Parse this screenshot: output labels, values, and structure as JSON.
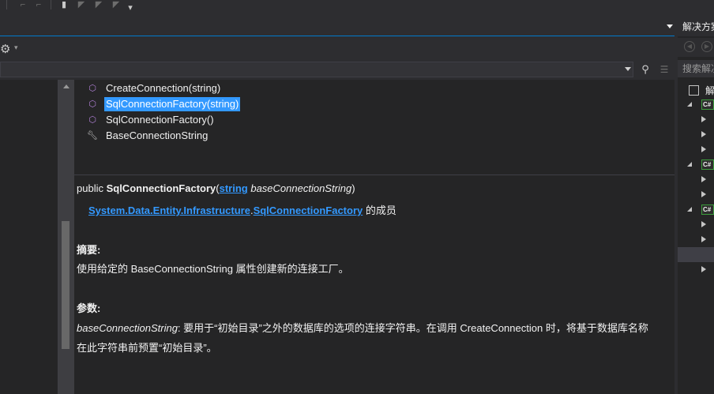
{
  "toolbar": {
    "icons": [
      "comment-icon",
      "uncomment-icon",
      "bookmark-icon",
      "prev-bookmark-icon",
      "next-bookmark-icon",
      "clear-bookmark-icon",
      "overflow-icon"
    ]
  },
  "object_browser": {
    "settings_icon": "gear-icon",
    "search": {
      "value": "",
      "placeholder": ""
    },
    "members": [
      {
        "icon": "method-icon",
        "label": "CreateConnection(string)",
        "selected": false
      },
      {
        "icon": "method-icon",
        "label": "SqlConnectionFactory(string)",
        "selected": true
      },
      {
        "icon": "method-icon",
        "label": "SqlConnectionFactory()",
        "selected": false
      },
      {
        "icon": "property-icon",
        "label": "BaseConnectionString",
        "selected": false
      }
    ],
    "detail": {
      "sig_public": "public ",
      "sig_name": "SqlConnectionFactory",
      "sig_open": "(",
      "sig_type": "string",
      "sig_param": " baseConnectionString",
      "sig_close": ")",
      "member_of_ns": "System.Data.Entity.Infrastructure",
      "member_of_dot": ".",
      "member_of_class": "SqlConnectionFactory",
      "member_of_suffix": " 的成员",
      "summary_heading": "摘要:",
      "summary_text": "使用给定的 BaseConnectionString 属性创建新的连接工厂。",
      "params_heading": "参数:",
      "param_name": "baseConnectionString",
      "param_text_1": ": 要用于“初始目录”之外的数据库的选项的连接字符串。在调用 CreateConnection 时，将基于数据库名称",
      "param_text_2": "在此字符串前预置“初始目录”。"
    }
  },
  "solution_explorer": {
    "title": "解决方案",
    "search_placeholder": "搜索解决",
    "root_label": "解",
    "project_badge": "C#"
  },
  "colors": {
    "accent": "#007acc",
    "selection": "#3399ff",
    "link": "#3399ff",
    "method_icon": "#b180d7"
  }
}
